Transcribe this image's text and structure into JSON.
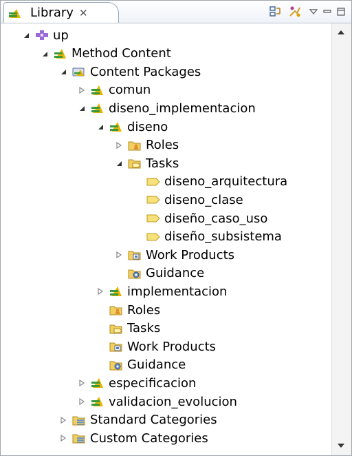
{
  "view": {
    "tab_title": "Library",
    "close_glyph": "✕",
    "toolbar": [
      "link-with-editor-icon",
      "layout-icon",
      "view-menu-icon",
      "minimize-icon",
      "maximize-icon"
    ]
  },
  "tree": [
    {
      "label": "up",
      "icon": "plugin-icon",
      "expander": "expanded",
      "level": 0
    },
    {
      "label": "Method Content",
      "icon": "content-package-icon",
      "expander": "expanded",
      "level": 1
    },
    {
      "label": "Content Packages",
      "icon": "content-packages-folder-icon",
      "expander": "expanded",
      "level": 2
    },
    {
      "label": "comun",
      "icon": "content-package-icon",
      "expander": "collapsed",
      "level": 3
    },
    {
      "label": "diseno_implementacion",
      "icon": "content-package-icon",
      "expander": "expanded",
      "level": 3
    },
    {
      "label": "diseno",
      "icon": "content-package-icon",
      "expander": "expanded",
      "level": 4
    },
    {
      "label": "Roles",
      "icon": "roles-folder-icon",
      "expander": "collapsed",
      "level": 5
    },
    {
      "label": "Tasks",
      "icon": "tasks-folder-icon",
      "expander": "expanded",
      "level": 5
    },
    {
      "label": "diseno_arquitectura",
      "icon": "task-icon",
      "expander": "none",
      "level": 6
    },
    {
      "label": "diseno_clase",
      "icon": "task-icon",
      "expander": "none",
      "level": 6
    },
    {
      "label": "diseño_caso_uso",
      "icon": "task-icon",
      "expander": "none",
      "level": 6
    },
    {
      "label": "diseño_subsistema",
      "icon": "task-icon",
      "expander": "none",
      "level": 6
    },
    {
      "label": "Work Products",
      "icon": "work-products-folder-icon",
      "expander": "collapsed",
      "level": 5
    },
    {
      "label": "Guidance",
      "icon": "guidance-folder-icon",
      "expander": "none",
      "level": 5
    },
    {
      "label": "implementacion",
      "icon": "content-package-icon",
      "expander": "collapsed",
      "level": 4
    },
    {
      "label": "Roles",
      "icon": "roles-folder-icon",
      "expander": "none",
      "level": 4
    },
    {
      "label": "Tasks",
      "icon": "tasks-folder-icon",
      "expander": "none",
      "level": 4
    },
    {
      "label": "Work Products",
      "icon": "work-products-folder-icon",
      "expander": "none",
      "level": 4
    },
    {
      "label": "Guidance",
      "icon": "guidance-folder-icon",
      "expander": "none",
      "level": 4
    },
    {
      "label": "especificacion",
      "icon": "content-package-icon",
      "expander": "collapsed",
      "level": 3
    },
    {
      "label": "validacion_evolucion",
      "icon": "content-package-icon",
      "expander": "collapsed",
      "level": 3
    },
    {
      "label": "Standard Categories",
      "icon": "categories-icon",
      "expander": "collapsed",
      "level": 2
    },
    {
      "label": "Custom Categories",
      "icon": "categories-icon",
      "expander": "collapsed",
      "level": 2
    }
  ],
  "colors": {
    "package_green": "#3a9a3a",
    "package_yellow": "#e8b400",
    "task_yellow": "#f5e27a",
    "folder_yellow": "#f2d060",
    "category_blue": "#6a96c8",
    "plugin_purple": "#9a6ad8"
  }
}
